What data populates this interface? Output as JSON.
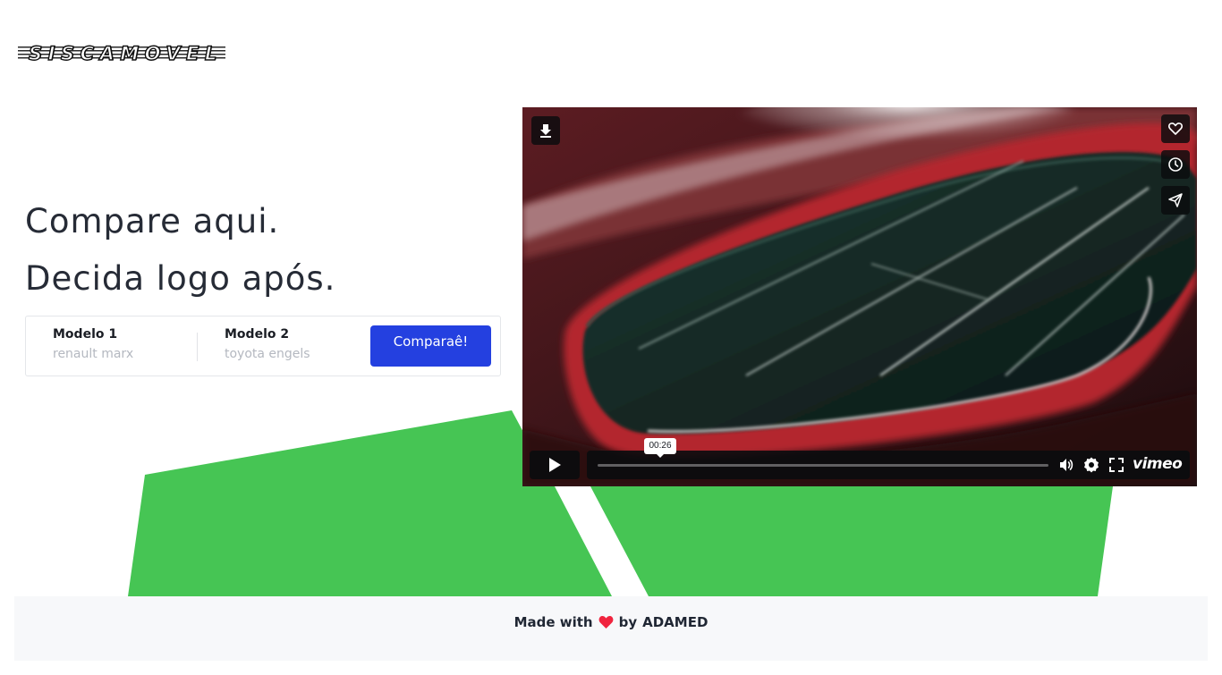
{
  "brand": {
    "logo_text": "SISCAMOVEL"
  },
  "hero": {
    "line1": "Compare aqui.",
    "line2": "Decida logo após."
  },
  "compare_form": {
    "model1_label": "Modelo 1",
    "model1_placeholder": "renault marx",
    "model2_label": "Modelo 2",
    "model2_placeholder": "toyota engels",
    "submit_label": "Comparaê!"
  },
  "video_player": {
    "hover_time": "00:26",
    "progress_fraction": 0,
    "logo": "vimeo",
    "icons": [
      "download-icon",
      "heart-icon",
      "clock-icon",
      "paper-plane-icon",
      "play-icon",
      "volume-icon",
      "gear-icon",
      "fullscreen-icon"
    ]
  },
  "footer": {
    "made_with": "Made with",
    "by": "by",
    "author": "ADAMED",
    "heart_icon": "heart-icon"
  },
  "colors": {
    "accent_green": "#46c554",
    "button_blue": "#2440e0",
    "heart_red": "#f0243e"
  }
}
